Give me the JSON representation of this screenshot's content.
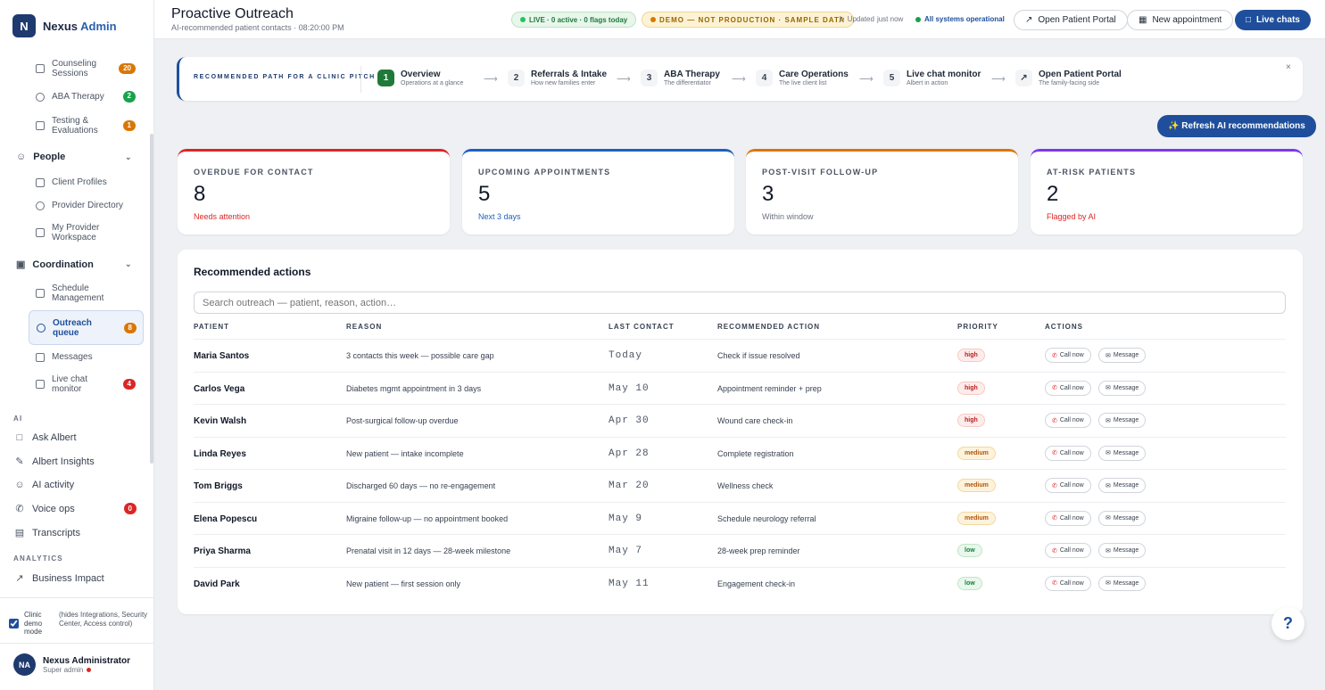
{
  "brand": {
    "name": "Nexus",
    "accent": "Admin",
    "logo": "N"
  },
  "sidebar": {
    "care_items": [
      {
        "label": "Counseling Sessions",
        "badge": "20"
      },
      {
        "label": "ABA Therapy",
        "badge": "2"
      },
      {
        "label": "Testing & Evaluations",
        "badge": "1"
      }
    ],
    "people": {
      "label": "People",
      "items": [
        "Client Profiles",
        "Provider Directory",
        "My Provider Workspace"
      ]
    },
    "coordination": {
      "label": "Coordination",
      "items": [
        {
          "label": "Schedule Management",
          "badge": ""
        },
        {
          "label": "Outreach queue",
          "badge": "8"
        },
        {
          "label": "Messages",
          "badge": ""
        },
        {
          "label": "Live chat monitor",
          "badge": "4"
        }
      ]
    },
    "ai_section": "AI",
    "ai_items": [
      {
        "label": "Ask Albert",
        "badge": ""
      },
      {
        "label": "Albert Insights",
        "badge": ""
      },
      {
        "label": "AI activity",
        "badge": ""
      },
      {
        "label": "Voice ops",
        "badge": "0"
      },
      {
        "label": "Transcripts",
        "badge": ""
      }
    ],
    "analytics_section": "ANALYTICS",
    "analytics_items": [
      "Business Impact"
    ],
    "demo_mode": {
      "label": "Clinic demo mode",
      "note": "(hides Integrations, Security Center, Access control)",
      "checked": true
    },
    "user": {
      "name": "Nexus Administrator",
      "role": "Super admin",
      "initials": "NA"
    }
  },
  "header": {
    "title": "Proactive Outreach",
    "subtitle": "AI-recommended patient contacts · 08:20:00 PM",
    "live_pill": "LIVE · 0 active · 0 flags today",
    "demo_pill": "DEMO — NOT PRODUCTION · SAMPLE DATA",
    "updated": "Updated",
    "updated_when": "just now",
    "systems": "All systems operational",
    "open_portal": "Open Patient Portal",
    "new_appt": "New appointment",
    "live_chats": "Live chats"
  },
  "path": {
    "label": "RECOMMENDED PATH FOR A CLINIC PITCH",
    "close": "×",
    "steps": [
      {
        "num": "1",
        "title": "Overview",
        "sub": "Operations at a glance"
      },
      {
        "num": "2",
        "title": "Referrals & Intake",
        "sub": "How new families enter"
      },
      {
        "num": "3",
        "title": "ABA Therapy",
        "sub": "The differentiator"
      },
      {
        "num": "4",
        "title": "Care Operations",
        "sub": "The live client list"
      },
      {
        "num": "5",
        "title": "Live chat monitor",
        "sub": "Albert in action"
      },
      {
        "num": "↗",
        "title": "Open Patient Portal",
        "sub": "The family-facing side"
      }
    ]
  },
  "refresh_btn": "✨ Refresh AI recommendations",
  "stats": [
    {
      "label": "OVERDUE FOR CONTACT",
      "value": "8",
      "sub": "Needs attention",
      "color": "#dc2626"
    },
    {
      "label": "UPCOMING APPOINTMENTS",
      "value": "5",
      "sub": "Next 3 days",
      "color": "#1f5fbf"
    },
    {
      "label": "POST-VISIT FOLLOW-UP",
      "value": "3",
      "sub": "Within window",
      "color": "#d97706"
    },
    {
      "label": "AT-RISK PATIENTS",
      "value": "2",
      "sub": "Flagged by AI",
      "color": "#7c3aed"
    }
  ],
  "table": {
    "title": "Recommended actions",
    "search_placeholder": "Search outreach — patient, reason, action…",
    "headers": [
      "PATIENT",
      "REASON",
      "LAST CONTACT",
      "RECOMMENDED ACTION",
      "PRIORITY",
      "ACTIONS"
    ],
    "call": "Call now",
    "message": "Message",
    "rows": [
      {
        "patient": "Maria Santos",
        "reason": "3 contacts this week — possible care gap",
        "last": "Today",
        "action": "Check if issue resolved",
        "priority": "high"
      },
      {
        "patient": "Carlos Vega",
        "reason": "Diabetes mgmt appointment in 3 days",
        "last": "May 10",
        "action": "Appointment reminder + prep",
        "priority": "high"
      },
      {
        "patient": "Kevin Walsh",
        "reason": "Post-surgical follow-up overdue",
        "last": "Apr 30",
        "action": "Wound care check-in",
        "priority": "high"
      },
      {
        "patient": "Linda Reyes",
        "reason": "New patient — intake incomplete",
        "last": "Apr 28",
        "action": "Complete registration",
        "priority": "medium"
      },
      {
        "patient": "Tom Briggs",
        "reason": "Discharged 60 days — no re-engagement",
        "last": "Mar 20",
        "action": "Wellness check",
        "priority": "medium"
      },
      {
        "patient": "Elena Popescu",
        "reason": "Migraine follow-up — no appointment booked",
        "last": "May 9",
        "action": "Schedule neurology referral",
        "priority": "medium"
      },
      {
        "patient": "Priya Sharma",
        "reason": "Prenatal visit in 12 days — 28-week milestone",
        "last": "May 7",
        "action": "28-week prep reminder",
        "priority": "low"
      },
      {
        "patient": "David Park",
        "reason": "New patient — first session only",
        "last": "May 11",
        "action": "Engagement check-in",
        "priority": "low"
      }
    ]
  },
  "help": "?"
}
